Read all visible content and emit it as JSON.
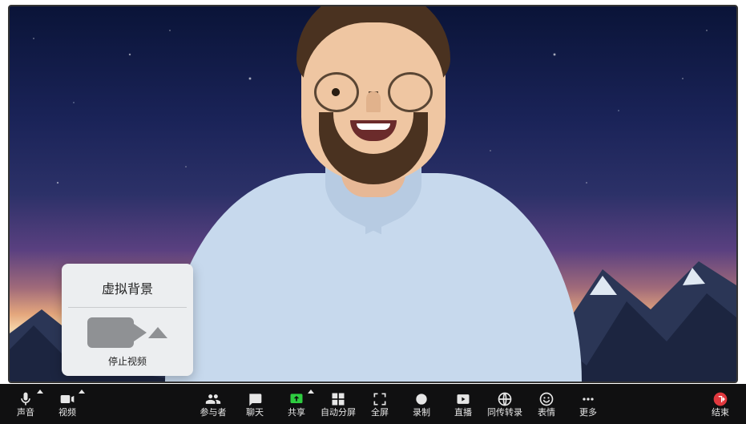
{
  "popover": {
    "title": "虚拟背景",
    "stop_video_label": "停止视频"
  },
  "toolbar": {
    "audio": "声音",
    "video": "视频",
    "participants": "参与者",
    "chat": "聊天",
    "share": "共享",
    "auto_split": "自动分屏",
    "fullscreen": "全屏",
    "record": "录制",
    "live": "直播",
    "interpretation": "同传转录",
    "reactions": "表情",
    "more": "更多",
    "end": "结束"
  }
}
